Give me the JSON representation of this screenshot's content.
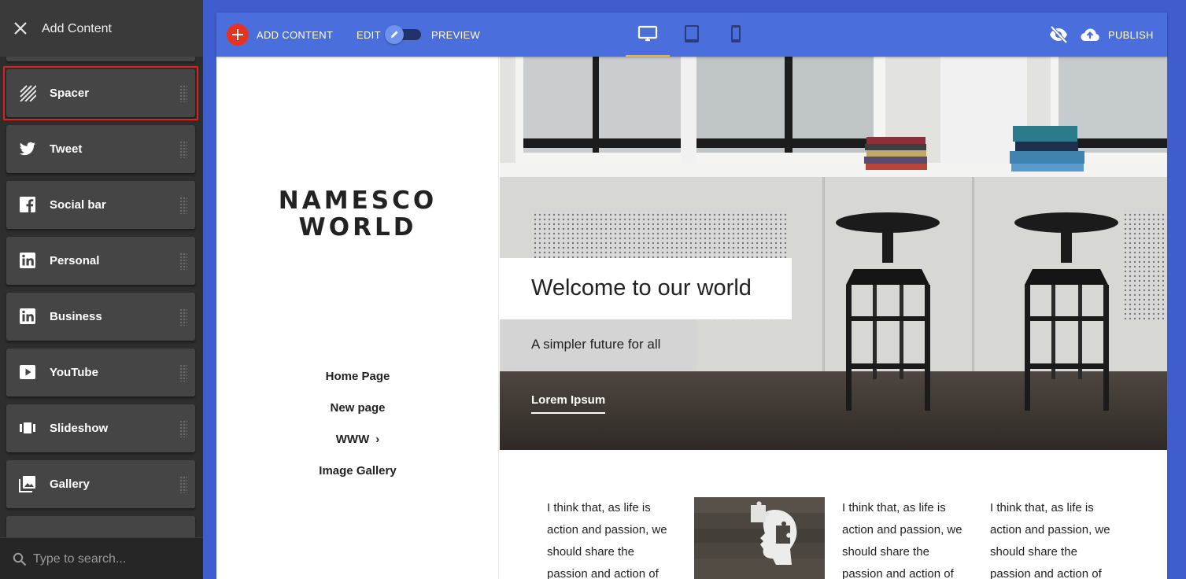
{
  "sidebar": {
    "title": "Add Content",
    "items": [
      {
        "label": "Spacer",
        "icon": "spacer-icon"
      },
      {
        "label": "Tweet",
        "icon": "twitter-icon"
      },
      {
        "label": "Social bar",
        "icon": "facebook-icon"
      },
      {
        "label": "Personal",
        "icon": "linkedin-icon"
      },
      {
        "label": "Business",
        "icon": "linkedin-icon"
      },
      {
        "label": "YouTube",
        "icon": "youtube-icon"
      },
      {
        "label": "Slideshow",
        "icon": "slideshow-icon"
      },
      {
        "label": "Gallery",
        "icon": "gallery-icon"
      }
    ],
    "selected": "Spacer",
    "search_placeholder": "Type to search..."
  },
  "toolbar": {
    "add_content": "ADD CONTENT",
    "edit": "EDIT",
    "preview": "PREVIEW",
    "publish": "PUBLISH",
    "active_device": "desktop"
  },
  "site": {
    "brand_line1": "NAMESCO",
    "brand_line2": "WORLD",
    "nav": [
      "Home Page",
      "New page",
      "WWW",
      "Image Gallery"
    ],
    "hero_title": "Welcome to our world",
    "hero_subtitle": "A simpler future for all",
    "hero_link": "Lorem Ipsum",
    "paragraph": "I think that, as life is action and passion, we should share the passion and action of"
  },
  "colors": {
    "accent_blue": "#4a6fdc",
    "add_red": "#e53322",
    "selection_red": "#e0201f",
    "device_underline": "#f2b728"
  }
}
